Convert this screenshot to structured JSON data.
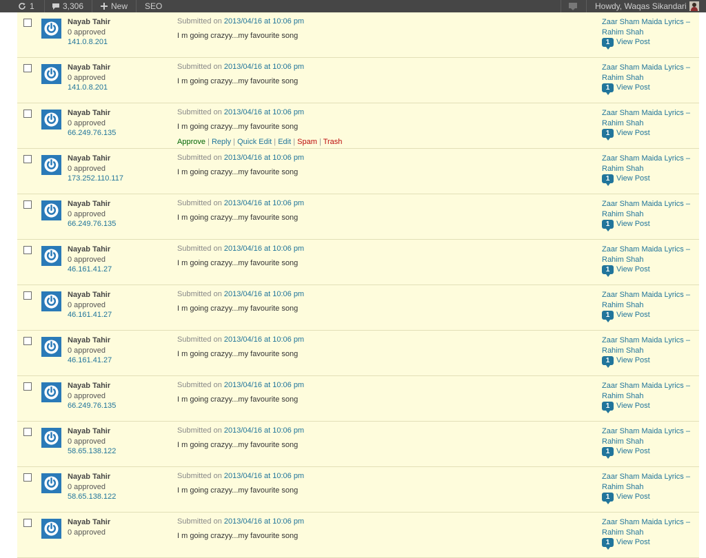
{
  "admin_bar": {
    "updates_count": "1",
    "comments_count": "3,306",
    "new_label": "New",
    "seo_label": "SEO",
    "howdy": "Howdy, Waqas Sikandari"
  },
  "actions": {
    "approve": "Approve",
    "reply": "Reply",
    "quick_edit": "Quick Edit",
    "edit": "Edit",
    "spam": "Spam",
    "trash": "Trash"
  },
  "comments": [
    {
      "author": "Nayab Tahir",
      "approved": "0 approved",
      "ip": "141.0.8.201",
      "submitted_prefix": "Submitted on",
      "date": "2013/04/16 at 10:06 pm",
      "text": "I m going crazyy...my favourite song",
      "post_title_1": "Zaar Sham Maida Lyrics –",
      "post_title_2": "Rahim Shah",
      "count": "1",
      "view": "View Post",
      "show_actions": false
    },
    {
      "author": "Nayab Tahir",
      "approved": "0 approved",
      "ip": "141.0.8.201",
      "submitted_prefix": "Submitted on",
      "date": "2013/04/16 at 10:06 pm",
      "text": "I m going crazyy...my favourite song",
      "post_title_1": "Zaar Sham Maida Lyrics –",
      "post_title_2": "Rahim Shah",
      "count": "1",
      "view": "View Post",
      "show_actions": false
    },
    {
      "author": "Nayab Tahir",
      "approved": "0 approved",
      "ip": "66.249.76.135",
      "submitted_prefix": "Submitted on",
      "date": "2013/04/16 at 10:06 pm",
      "text": "I m going crazyy...my favourite song",
      "post_title_1": "Zaar Sham Maida Lyrics –",
      "post_title_2": "Rahim Shah",
      "count": "1",
      "view": "View Post",
      "show_actions": true
    },
    {
      "author": "Nayab Tahir",
      "approved": "0 approved",
      "ip": "173.252.110.117",
      "submitted_prefix": "Submitted on",
      "date": "2013/04/16 at 10:06 pm",
      "text": "I m going crazyy...my favourite song",
      "post_title_1": "Zaar Sham Maida Lyrics –",
      "post_title_2": "Rahim Shah",
      "count": "1",
      "view": "View Post",
      "show_actions": false
    },
    {
      "author": "Nayab Tahir",
      "approved": "0 approved",
      "ip": "66.249.76.135",
      "submitted_prefix": "Submitted on",
      "date": "2013/04/16 at 10:06 pm",
      "text": "I m going crazyy...my favourite song",
      "post_title_1": "Zaar Sham Maida Lyrics –",
      "post_title_2": "Rahim Shah",
      "count": "1",
      "view": "View Post",
      "show_actions": false
    },
    {
      "author": "Nayab Tahir",
      "approved": "0 approved",
      "ip": "46.161.41.27",
      "submitted_prefix": "Submitted on",
      "date": "2013/04/16 at 10:06 pm",
      "text": "I m going crazyy...my favourite song",
      "post_title_1": "Zaar Sham Maida Lyrics –",
      "post_title_2": "Rahim Shah",
      "count": "1",
      "view": "View Post",
      "show_actions": false
    },
    {
      "author": "Nayab Tahir",
      "approved": "0 approved",
      "ip": "46.161.41.27",
      "submitted_prefix": "Submitted on",
      "date": "2013/04/16 at 10:06 pm",
      "text": "I m going crazyy...my favourite song",
      "post_title_1": "Zaar Sham Maida Lyrics –",
      "post_title_2": "Rahim Shah",
      "count": "1",
      "view": "View Post",
      "show_actions": false
    },
    {
      "author": "Nayab Tahir",
      "approved": "0 approved",
      "ip": "46.161.41.27",
      "submitted_prefix": "Submitted on",
      "date": "2013/04/16 at 10:06 pm",
      "text": "I m going crazyy...my favourite song",
      "post_title_1": "Zaar Sham Maida Lyrics –",
      "post_title_2": "Rahim Shah",
      "count": "1",
      "view": "View Post",
      "show_actions": false
    },
    {
      "author": "Nayab Tahir",
      "approved": "0 approved",
      "ip": "66.249.76.135",
      "submitted_prefix": "Submitted on",
      "date": "2013/04/16 at 10:06 pm",
      "text": "I m going crazyy...my favourite song",
      "post_title_1": "Zaar Sham Maida Lyrics –",
      "post_title_2": "Rahim Shah",
      "count": "1",
      "view": "View Post",
      "show_actions": false
    },
    {
      "author": "Nayab Tahir",
      "approved": "0 approved",
      "ip": "58.65.138.122",
      "submitted_prefix": "Submitted on",
      "date": "2013/04/16 at 10:06 pm",
      "text": "I m going crazyy...my favourite song",
      "post_title_1": "Zaar Sham Maida Lyrics –",
      "post_title_2": "Rahim Shah",
      "count": "1",
      "view": "View Post",
      "show_actions": false
    },
    {
      "author": "Nayab Tahir",
      "approved": "0 approved",
      "ip": "58.65.138.122",
      "submitted_prefix": "Submitted on",
      "date": "2013/04/16 at 10:06 pm",
      "text": "I m going crazyy...my favourite song",
      "post_title_1": "Zaar Sham Maida Lyrics –",
      "post_title_2": "Rahim Shah",
      "count": "1",
      "view": "View Post",
      "show_actions": false
    },
    {
      "author": "Nayab Tahir",
      "approved": "0 approved",
      "ip": "",
      "submitted_prefix": "Submitted on",
      "date": "2013/04/16 at 10:06 pm",
      "text": "I m going crazyy...my favourite song",
      "post_title_1": "Zaar Sham Maida Lyrics –",
      "post_title_2": "Rahim Shah",
      "count": "1",
      "view": "View Post",
      "show_actions": false
    }
  ]
}
